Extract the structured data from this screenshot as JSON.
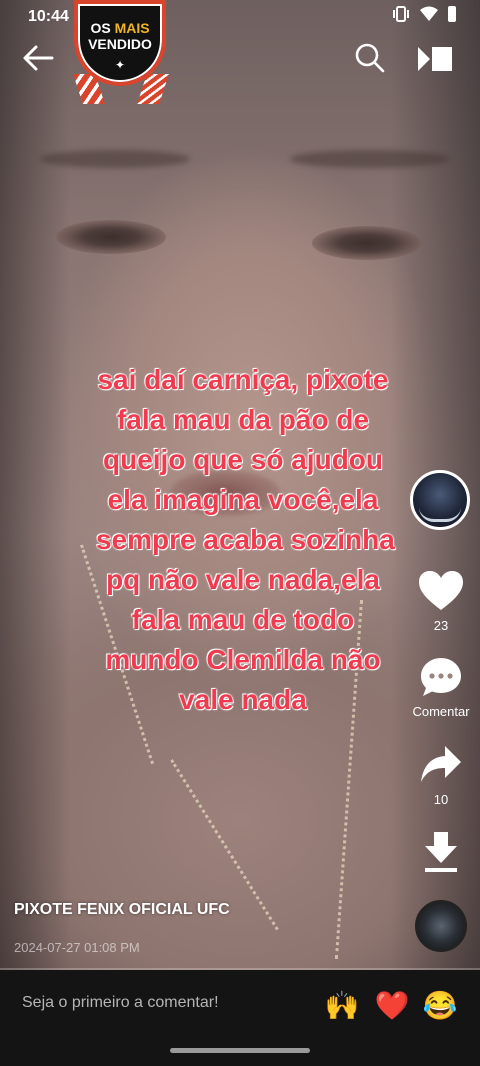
{
  "status_bar": {
    "time": "10:44"
  },
  "badge": {
    "line1_a": "OS",
    "line1_b": "MAIS",
    "line2": "VENDIDO",
    "star": "✦"
  },
  "caption": [
    "sai daí carniça, pixote",
    "fala mau da pão de",
    "queijo que só ajudou",
    "ela imagina você,ela",
    "sempre acaba sozinha",
    "pq não vale nada,ela",
    "fala mau de todo",
    "mundo Clemilda não",
    "vale nada"
  ],
  "actions": {
    "like_count": "23",
    "comment_label": "Comentar",
    "share_count": "10"
  },
  "post": {
    "author": "PIXOTE FENIX OFICIAL UFC",
    "date": "2024-07-27 01:08 PM"
  },
  "comment_bar": {
    "placeholder": "Seja o primeiro a comentar!",
    "quick_reactions": [
      "🙌",
      "❤️",
      "😂"
    ]
  },
  "colors": {
    "caption": "#ef3b4f",
    "badge_ring": "#d9442c",
    "badge_accent": "#f0b429"
  }
}
